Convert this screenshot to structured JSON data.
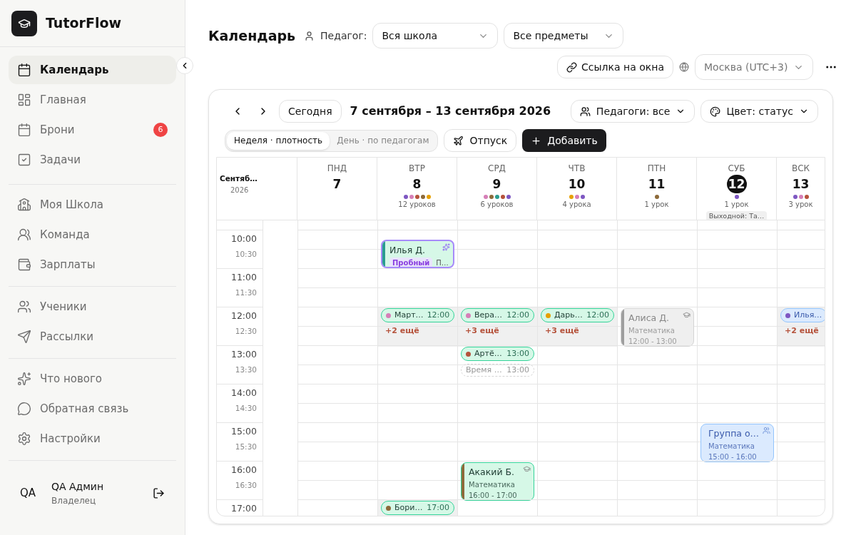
{
  "sidebar": {
    "brand": "TutorFlow",
    "groups": [
      {
        "items": [
          {
            "label": "Календарь",
            "selected": true
          },
          {
            "label": "Главная",
            "selected": false
          },
          {
            "label": "Брони",
            "selected": false,
            "badge": "6"
          },
          {
            "label": "Задачи",
            "selected": false
          }
        ]
      },
      {
        "items": [
          {
            "label": "Моя Школа",
            "selected": false
          },
          {
            "label": "Команда",
            "selected": false
          },
          {
            "label": "Зарплаты",
            "selected": false
          }
        ]
      },
      {
        "items": [
          {
            "label": "Ученики",
            "selected": false
          },
          {
            "label": "Рассылки",
            "selected": false
          }
        ]
      },
      {
        "items": [
          {
            "label": "Что нового",
            "selected": false
          },
          {
            "label": "Обратная связь",
            "selected": false
          },
          {
            "label": "Настройки",
            "selected": false
          }
        ]
      }
    ],
    "user": {
      "initials": "QA",
      "name": "QA Админ",
      "role": "Владелец"
    }
  },
  "header": {
    "title": "Календарь",
    "teacher_label": "Педагог:",
    "teacher_select": "Вся школа",
    "subject_select": "Все предметы",
    "link_button": "Ссылка на окна",
    "timezone_select": "Москва (UTC+3)"
  },
  "calendar": {
    "today_button": "Сегодня",
    "range": "7 сентября – 13 сентября 2026",
    "teachers_filter": "Педагоги: все",
    "color_filter": "Цвет: статус",
    "view_tabs": [
      {
        "label": "Неделя · плотность",
        "selected": true
      },
      {
        "label": "День · по педагогам",
        "selected": false
      }
    ],
    "vacation_button": "Отпуск",
    "add_button": "Добавить",
    "month": "Сентяб…",
    "year": "2026",
    "days": [
      {
        "name": "ПНД",
        "number": "7",
        "today": false
      },
      {
        "name": "ВТР",
        "number": "8",
        "today": false,
        "dots": [
          {
            "color": "#7e57c2"
          },
          {
            "color": "#d67fb8"
          },
          {
            "color": "#b5523b"
          },
          {
            "color": "#8d6a3a"
          },
          {
            "color": "#e6a000"
          }
        ],
        "count": "12 уроков"
      },
      {
        "name": "СРД",
        "number": "9",
        "today": false,
        "dots": [
          {
            "color": "#d67fb8"
          },
          {
            "color": "#8d6a3a"
          },
          {
            "color": "#2a9d8f"
          },
          {
            "color": "#b5523b"
          },
          {
            "color": "#7e57c2"
          }
        ],
        "count": "6 уроков"
      },
      {
        "name": "ЧТВ",
        "number": "10",
        "today": false,
        "dots": [
          {
            "color": "#e6a000"
          },
          {
            "color": "#d67fb8"
          },
          {
            "color": "#7e57c2"
          }
        ],
        "count": "4 урока"
      },
      {
        "name": "ПТН",
        "number": "11",
        "today": false,
        "dots": [
          {
            "color": "#8d6a3a"
          }
        ],
        "count": "1 урок"
      },
      {
        "name": "СУБ",
        "number": "12",
        "today": true,
        "dots": [
          {
            "color": "#7e57c2"
          }
        ],
        "count": "1 урок",
        "note": "Выходной: Та…"
      },
      {
        "name": "ВСК",
        "number": "13",
        "today": false,
        "dots": [
          {
            "color": "#7e57c2"
          },
          {
            "color": "#d67fb8"
          },
          {
            "color": "#b5523b"
          }
        ],
        "count": "3 урок"
      }
    ],
    "hours": [
      {
        "time": "10:00",
        "half": "10:30",
        "cells": [
          {
            "shaded": false
          },
          {
            "shaded": false,
            "events": [
              {
                "kind": "trial_card",
                "title": "Илья Д.",
                "badge": "Пробный",
                "subtitle": "П…",
                "color": "#2a9d8f"
              }
            ]
          },
          {
            "shaded": false
          },
          {
            "shaded": false
          },
          {
            "shaded": false
          },
          {
            "shaded": false
          },
          {
            "shaded": false
          }
        ]
      },
      {
        "time": "11:00",
        "half": "11:30",
        "cells": [
          {
            "shaded": false
          },
          {
            "shaded": false
          },
          {
            "shaded": false
          },
          {
            "shaded": false
          },
          {
            "shaded": false
          },
          {
            "shaded": false
          },
          {
            "shaded": false
          }
        ]
      },
      {
        "time": "12:00",
        "half": "12:30",
        "cells": [
          {
            "shaded": false
          },
          {
            "shaded": true,
            "events": [
              {
                "kind": "pill",
                "color": "#d67fb8",
                "name": "Март…",
                "time": "12:00"
              },
              {
                "kind": "more",
                "text": "+2 ещё"
              }
            ]
          },
          {
            "shaded": true,
            "events": [
              {
                "kind": "pill",
                "color": "#d67fb8",
                "name": "Вера…",
                "time": "12:00"
              },
              {
                "kind": "more",
                "text": "+3 ещё"
              }
            ]
          },
          {
            "shaded": true,
            "events": [
              {
                "kind": "pill",
                "color": "#e6a000",
                "name": "Дарь…",
                "time": "12:00"
              },
              {
                "kind": "more",
                "text": "+3 ещё"
              }
            ]
          },
          {
            "shaded": false,
            "events": [
              {
                "kind": "gray_card",
                "title": "Алиса Д.",
                "subject": "Математика",
                "time": "12:00 - 13:00",
                "color": "#9e9e9e"
              }
            ]
          },
          {
            "shaded": false
          },
          {
            "shaded": true,
            "events": [
              {
                "kind": "blue_pill",
                "color": "#7e57c2",
                "name": "Илья…"
              },
              {
                "kind": "more",
                "text": "+2 ещё"
              }
            ]
          }
        ]
      },
      {
        "time": "13:00",
        "half": "13:30",
        "cells": [
          {
            "shaded": false
          },
          {
            "shaded": false
          },
          {
            "shaded": false,
            "events": [
              {
                "kind": "pill",
                "color": "#b5523b",
                "name": "Артё…",
                "time": "13:00"
              },
              {
                "kind": "ghost",
                "name": "Время …",
                "time": "13:00"
              }
            ]
          },
          {
            "shaded": false
          },
          {
            "shaded": false
          },
          {
            "shaded": false
          },
          {
            "shaded": false
          }
        ]
      },
      {
        "time": "14:00",
        "half": "14:30",
        "cells": [
          {
            "shaded": false
          },
          {
            "shaded": false
          },
          {
            "shaded": false
          },
          {
            "shaded": false
          },
          {
            "shaded": false
          },
          {
            "shaded": false
          },
          {
            "shaded": false
          }
        ]
      },
      {
        "time": "15:00",
        "half": "15:30",
        "cells": [
          {
            "shaded": false
          },
          {
            "shaded": false
          },
          {
            "shaded": false
          },
          {
            "shaded": false
          },
          {
            "shaded": false
          },
          {
            "shaded": false,
            "events": [
              {
                "kind": "blue_card",
                "title": "Группа о…",
                "subject": "Математика",
                "time": "15:00 - 16:00"
              }
            ]
          },
          {
            "shaded": false
          }
        ]
      },
      {
        "time": "16:00",
        "half": "16:30",
        "cells": [
          {
            "shaded": false
          },
          {
            "shaded": false
          },
          {
            "shaded": false,
            "events": [
              {
                "kind": "green_card",
                "title": "Акакий Б.",
                "subject": "Математика",
                "time": "16:00 - 17:00",
                "color": "#8d6a3a"
              }
            ]
          },
          {
            "shaded": false
          },
          {
            "shaded": false
          },
          {
            "shaded": false
          },
          {
            "shaded": false
          }
        ]
      },
      {
        "time": "17:00",
        "cells": [
          {
            "shaded": false
          },
          {
            "shaded": true,
            "events": [
              {
                "kind": "pill",
                "color": "#8d6a3a",
                "name": "Бори…",
                "time": "17:00"
              }
            ]
          },
          {
            "shaded": false
          },
          {
            "shaded": false
          },
          {
            "shaded": false
          },
          {
            "shaded": false
          },
          {
            "shaded": false
          }
        ]
      }
    ]
  }
}
